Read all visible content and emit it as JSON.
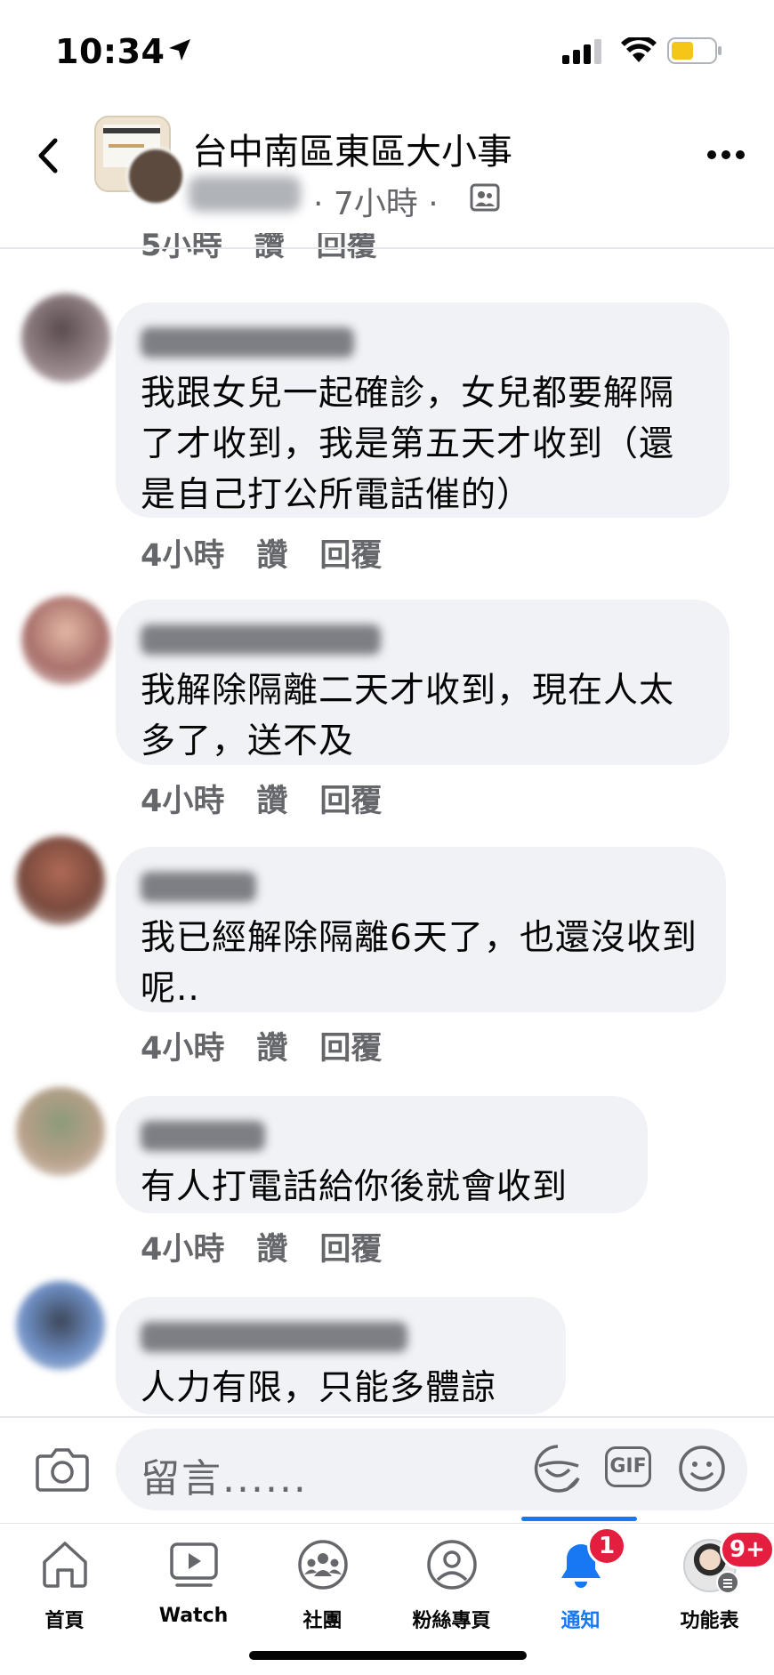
{
  "status_bar": {
    "time": "10:34"
  },
  "header": {
    "group_name": "台中南區東區大小事",
    "post_meta": "· 7小時 ·"
  },
  "partial_row": {
    "time": "5小時",
    "like": "讚",
    "reply": "回覆"
  },
  "comments": [
    {
      "text": "我跟女兒一起確診，女兒都要解隔了才收到，我是第五天才收到（還是自己打公所電話催的）",
      "time": "4小時",
      "like": "讚",
      "reply": "回覆",
      "avatar_color": "#7a6a6e"
    },
    {
      "text": "我解除隔離二天才收到，現在人太多了，送不及",
      "time": "4小時",
      "like": "讚",
      "reply": "回覆",
      "avatar_color": "#b08a86"
    },
    {
      "text": "我已經解除隔離6天了，也還沒收到呢..",
      "time": "4小時",
      "like": "讚",
      "reply": "回覆",
      "avatar_color": "#8a5a4a"
    },
    {
      "text": "有人打電話給你後就會收到",
      "time": "4小時",
      "like": "讚",
      "reply": "回覆",
      "avatar_color": "#a89680"
    },
    {
      "text": "人力有限，只能多體諒",
      "avatar_color": "#6d7a8f"
    }
  ],
  "composer": {
    "placeholder": "留言......",
    "gif_label": "GIF"
  },
  "tabs": [
    {
      "label": "首頁",
      "icon": "home-icon"
    },
    {
      "label": "Watch",
      "icon": "watch-icon"
    },
    {
      "label": "社團",
      "icon": "groups-icon"
    },
    {
      "label": "粉絲專頁",
      "icon": "pages-icon"
    },
    {
      "label": "通知",
      "icon": "bell-icon",
      "active": true,
      "badge": "1"
    },
    {
      "label": "功能表",
      "icon": "menu-icon",
      "badge": "9+"
    }
  ],
  "colors": {
    "accent": "#1877f2",
    "badge": "#e41e3f",
    "bubble": "#f0f2f5",
    "meta": "#65676b"
  }
}
